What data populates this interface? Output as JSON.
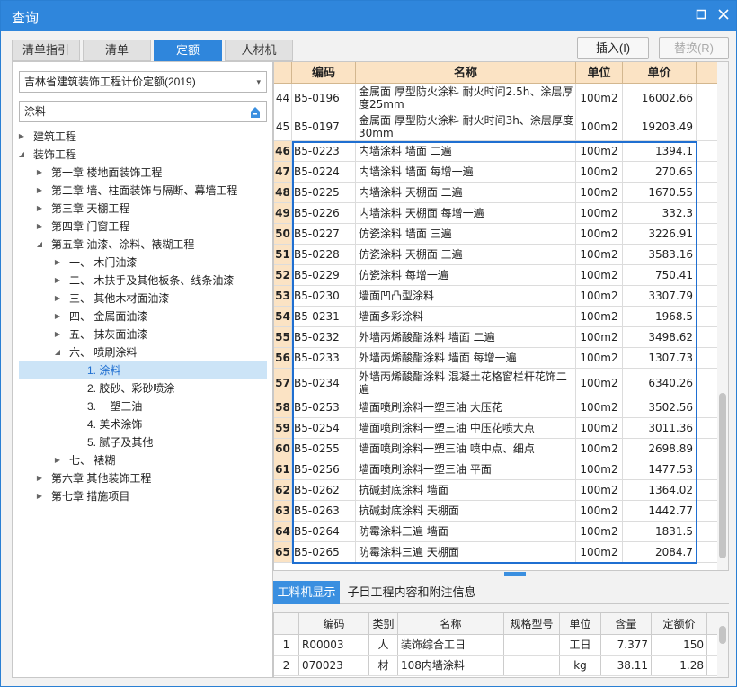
{
  "window": {
    "title": "查询"
  },
  "tabs": [
    "清单指引",
    "清单",
    "定额",
    "人材机"
  ],
  "buttons": {
    "insert": "插入(I)",
    "replace": "替换(R)"
  },
  "left": {
    "combo_value": "吉林省建筑装饰工程计价定额(2019)",
    "search_value": "涂料",
    "tree": [
      {
        "label": "建筑工程"
      },
      {
        "label": "装饰工程"
      },
      {
        "label": "第一章 楼地面装饰工程"
      },
      {
        "label": "第二章 墙、柱面装饰与隔断、幕墙工程"
      },
      {
        "label": "第三章 天棚工程"
      },
      {
        "label": "第四章 门窗工程"
      },
      {
        "label": "第五章 油漆、涂料、裱糊工程"
      },
      {
        "label": "一、 木门油漆"
      },
      {
        "label": "二、 木扶手及其他板条、线条油漆"
      },
      {
        "label": "三、 其他木材面油漆"
      },
      {
        "label": "四、 金属面油漆"
      },
      {
        "label": "五、 抹灰面油漆"
      },
      {
        "label": "六、 喷刷涂料"
      },
      {
        "label": "1. 涂料"
      },
      {
        "label": "2. 胶砂、彩砂喷涂"
      },
      {
        "label": "3. 一塑三油"
      },
      {
        "label": "4. 美术涂饰"
      },
      {
        "label": "5. 腻子及其他"
      },
      {
        "label": "七、 裱糊"
      },
      {
        "label": "第六章 其他装饰工程"
      },
      {
        "label": "第七章 措施项目"
      }
    ]
  },
  "grid": {
    "headers": {
      "code": "编码",
      "name": "名称",
      "unit": "单位",
      "price": "单价"
    },
    "rows": [
      {
        "n": "44",
        "code": "B5-0196",
        "name": "金属面 厚型防火涂料 耐火时间2.5h、涂层厚度25mm",
        "unit": "100m2",
        "price": "16002.66"
      },
      {
        "n": "45",
        "code": "B5-0197",
        "name": "金属面 厚型防火涂料 耐火时间3h、涂层厚度30mm",
        "unit": "100m2",
        "price": "19203.49"
      },
      {
        "n": "46",
        "code": "B5-0223",
        "name": "内墙涂料 墙面 二遍",
        "unit": "100m2",
        "price": "1394.1"
      },
      {
        "n": "47",
        "code": "B5-0224",
        "name": "内墙涂料 墙面 每增一遍",
        "unit": "100m2",
        "price": "270.65"
      },
      {
        "n": "48",
        "code": "B5-0225",
        "name": "内墙涂料 天棚面 二遍",
        "unit": "100m2",
        "price": "1670.55"
      },
      {
        "n": "49",
        "code": "B5-0226",
        "name": "内墙涂料 天棚面 每增一遍",
        "unit": "100m2",
        "price": "332.3"
      },
      {
        "n": "50",
        "code": "B5-0227",
        "name": "仿瓷涂料 墙面 三遍",
        "unit": "100m2",
        "price": "3226.91"
      },
      {
        "n": "51",
        "code": "B5-0228",
        "name": "仿瓷涂料 天棚面 三遍",
        "unit": "100m2",
        "price": "3583.16"
      },
      {
        "n": "52",
        "code": "B5-0229",
        "name": "仿瓷涂料 每增一遍",
        "unit": "100m2",
        "price": "750.41"
      },
      {
        "n": "53",
        "code": "B5-0230",
        "name": "墙面凹凸型涂料",
        "unit": "100m2",
        "price": "3307.79"
      },
      {
        "n": "54",
        "code": "B5-0231",
        "name": "墙面多彩涂料",
        "unit": "100m2",
        "price": "1968.5"
      },
      {
        "n": "55",
        "code": "B5-0232",
        "name": "外墙丙烯酸酯涂料 墙面 二遍",
        "unit": "100m2",
        "price": "3498.62"
      },
      {
        "n": "56",
        "code": "B5-0233",
        "name": "外墙丙烯酸酯涂料 墙面 每增一遍",
        "unit": "100m2",
        "price": "1307.73"
      },
      {
        "n": "57",
        "code": "B5-0234",
        "name": "外墙丙烯酸酯涂料 混凝土花格窗栏杆花饰二遍",
        "unit": "100m2",
        "price": "6340.26"
      },
      {
        "n": "58",
        "code": "B5-0253",
        "name": "墙面喷刷涂料一塑三油 大压花",
        "unit": "100m2",
        "price": "3502.56"
      },
      {
        "n": "59",
        "code": "B5-0254",
        "name": "墙面喷刷涂料一塑三油 中压花喷大点",
        "unit": "100m2",
        "price": "3011.36"
      },
      {
        "n": "60",
        "code": "B5-0255",
        "name": "墙面喷刷涂料一塑三油 喷中点、细点",
        "unit": "100m2",
        "price": "2698.89"
      },
      {
        "n": "61",
        "code": "B5-0256",
        "name": "墙面喷刷涂料一塑三油 平面",
        "unit": "100m2",
        "price": "1477.53"
      },
      {
        "n": "62",
        "code": "B5-0262",
        "name": "抗碱封底涂料 墙面",
        "unit": "100m2",
        "price": "1364.02"
      },
      {
        "n": "63",
        "code": "B5-0263",
        "name": "抗碱封底涂料 天棚面",
        "unit": "100m2",
        "price": "1442.77"
      },
      {
        "n": "64",
        "code": "B5-0264",
        "name": "防霉涂料三遍 墙面",
        "unit": "100m2",
        "price": "1831.5"
      },
      {
        "n": "65",
        "code": "B5-0265",
        "name": "防霉涂料三遍 天棚面",
        "unit": "100m2",
        "price": "2084.7"
      }
    ]
  },
  "bottom_tabs": [
    "工料机显示",
    "子目工程内容和附注信息"
  ],
  "bottom_grid": {
    "headers": [
      "编码",
      "类别",
      "名称",
      "规格型号",
      "单位",
      "含量",
      "定额价"
    ],
    "rows": [
      {
        "n": "1",
        "code": "R00003",
        "type": "人",
        "name": "装饰综合工日",
        "spec": "",
        "unit": "工日",
        "qty": "7.377",
        "price": "150"
      },
      {
        "n": "2",
        "code": "070023",
        "type": "材",
        "name": "108内墙涂料",
        "spec": "",
        "unit": "kg",
        "qty": "38.11",
        "price": "1.28"
      }
    ]
  },
  "colors": {
    "accent": "#2f86dc",
    "header": "#fbe3c4",
    "selection_border": "#1f6fd1",
    "tree_selected": "#cce4f7"
  }
}
